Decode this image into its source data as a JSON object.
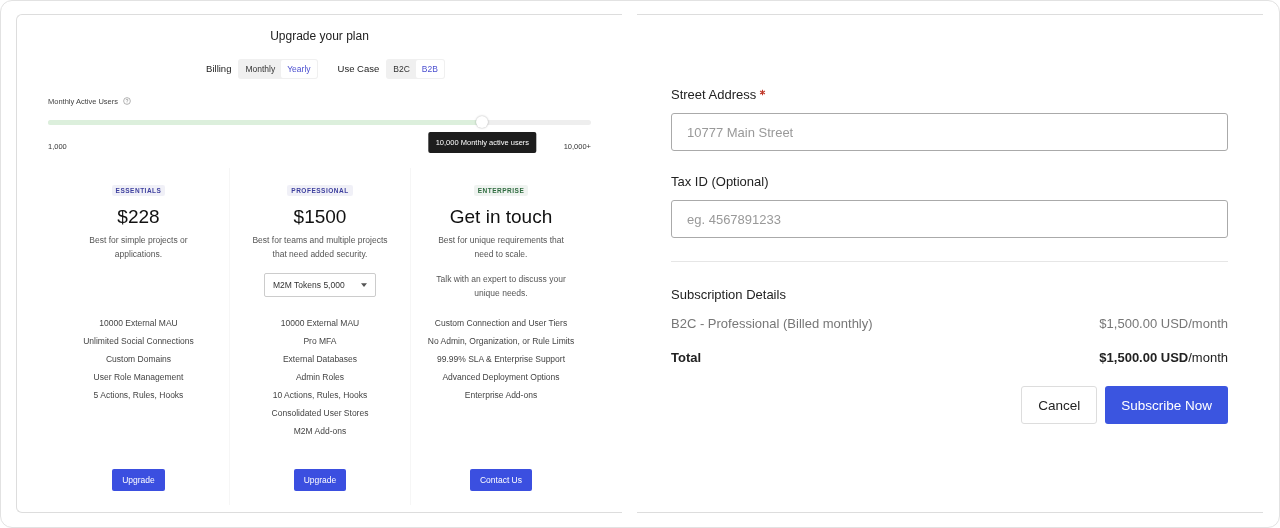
{
  "title": "Upgrade your plan",
  "toggles": [
    {
      "label": "Billing",
      "options": [
        {
          "label": "Monthly",
          "selected": false
        },
        {
          "label": "Yearly",
          "selected": true
        }
      ]
    },
    {
      "label": "Use Case",
      "options": [
        {
          "label": "B2C",
          "selected": false
        },
        {
          "label": "B2B",
          "selected": true
        }
      ]
    }
  ],
  "slider": {
    "label": "Monthly Active Users",
    "level": 0.8,
    "tooltip": "10,000 Monthly active users",
    "min_label": "1,000",
    "max_label": "10,000+"
  },
  "plans": [
    {
      "badge": "ESSENTIALS",
      "color": "#3d3f9e",
      "price": "$228",
      "description": [
        "Best for simple projects or applications."
      ],
      "features": [
        "10000 External MAU",
        "Unlimited Social Connections",
        "Custom Domains",
        "User Role Management",
        "5 Actions, Rules, Hooks"
      ],
      "button": "Upgrade"
    },
    {
      "badge": "PROFESSIONAL",
      "color": "#3d3f9e",
      "price": "$1500",
      "description": [
        "Best for teams and multiple projects that need added security."
      ],
      "dropdown": "M2M Tokens 5,000",
      "features": [
        "10000 External MAU",
        "Pro MFA",
        "External Databases",
        "Admin Roles",
        "10 Actions, Rules, Hooks",
        "Consolidated User Stores",
        "M2M Add-ons"
      ],
      "button": "Upgrade"
    },
    {
      "badge": "ENTERPRISE",
      "color": "#2e6b3e",
      "price": "Get in touch",
      "description": [
        "Best for unique requirements that need to scale.",
        "Talk with an expert to discuss your unique needs."
      ],
      "features": [
        "Custom Connection and User Tiers",
        "No Admin, Organization, or Rule Limits",
        "99.99% SLA & Enterprise Support",
        "Advanced Deployment Options",
        "Enterprise Add-ons"
      ],
      "button": "Contact Us"
    }
  ],
  "form": {
    "fields": [
      {
        "label": "Street Address",
        "required": true,
        "placeholder": "10777 Main Street"
      },
      {
        "label": "Tax ID (Optional)",
        "required": false,
        "placeholder": "eg. 4567891233"
      }
    ]
  },
  "subscription": {
    "heading": "Subscription Details",
    "line": {
      "label": "B2C - Professional (Billed monthly)",
      "amount": "$1,500.00 USD/month"
    },
    "total": {
      "label": "Total",
      "amount": "**$1,500.00 USD**/month"
    }
  },
  "buttons": [
    {
      "label": "Cancel",
      "kind": "secondary"
    },
    {
      "label": "Subscribe Now",
      "kind": "primary"
    }
  ]
}
